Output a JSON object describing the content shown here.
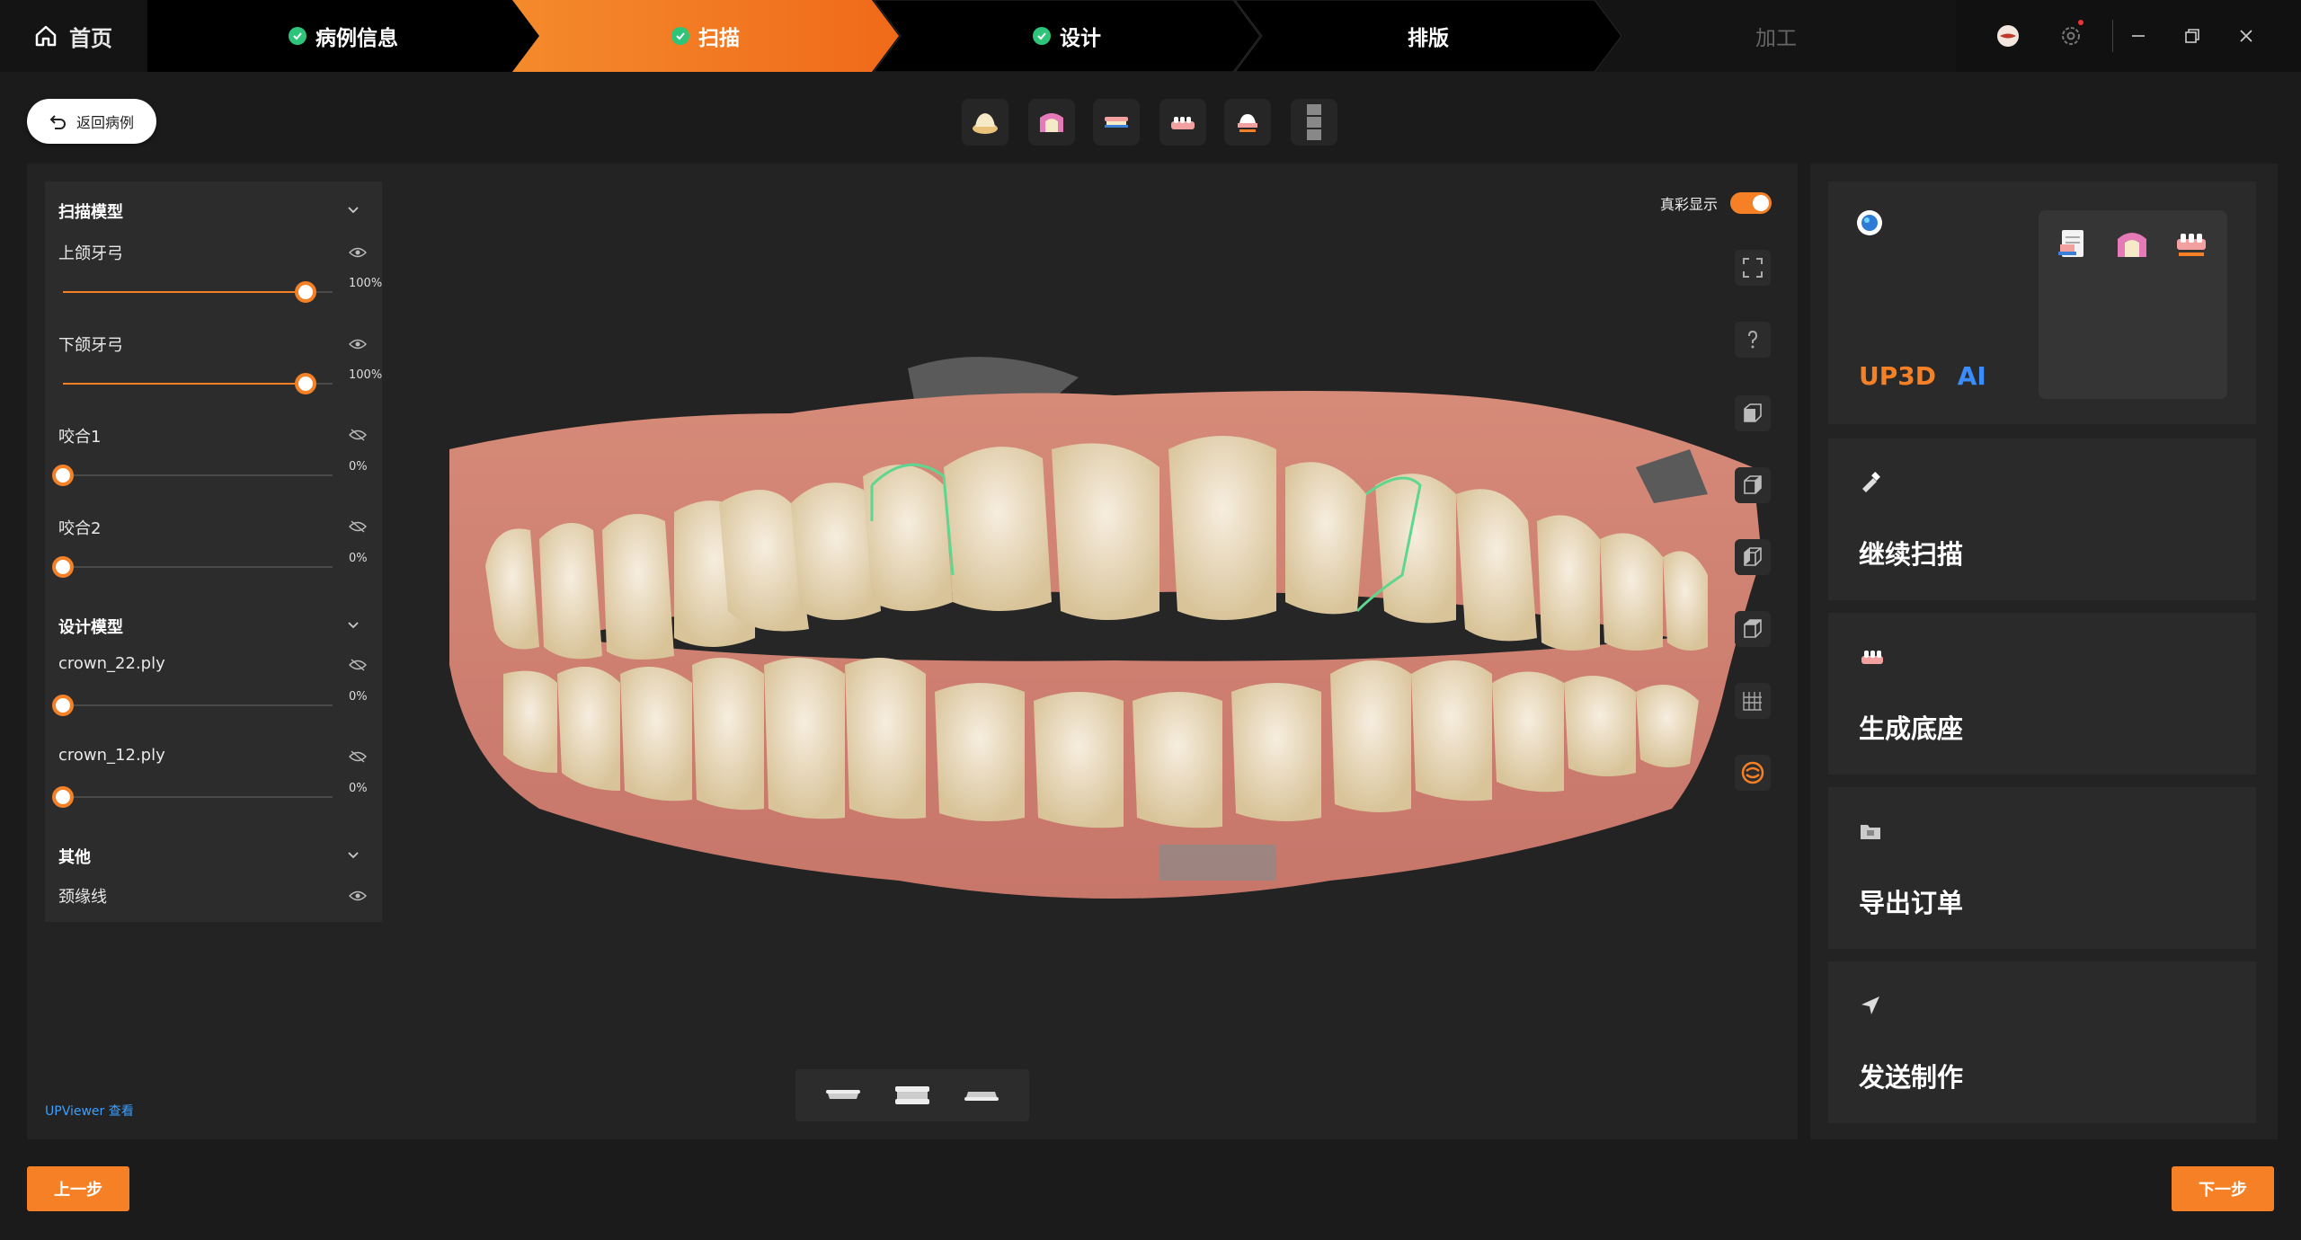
{
  "nav": {
    "home_label": "首页",
    "steps": [
      {
        "label": "病例信息",
        "state": "done"
      },
      {
        "label": "扫描",
        "state": "active"
      },
      {
        "label": "设计",
        "state": "done"
      },
      {
        "label": "排版",
        "state": "normal"
      },
      {
        "label": "加工",
        "state": "disabled"
      }
    ]
  },
  "toolbar": {
    "back_label": "返回病例",
    "tool_icons": [
      "crown-tool-icon",
      "gum-tool-icon",
      "arch-tool-icon",
      "base-tool-icon",
      "online-tool-icon",
      "grip-handle-icon"
    ]
  },
  "layers": {
    "scan_section": "扫描模型",
    "upper": {
      "label": "上颌牙弓",
      "pct_label": "100%",
      "value": 100
    },
    "lower": {
      "label": "下颌牙弓",
      "pct_label": "100%",
      "value": 100
    },
    "bite1": {
      "label": "咬合1",
      "pct_label": "0%",
      "value": 0
    },
    "bite2": {
      "label": "咬合2",
      "pct_label": "0%",
      "value": 0
    },
    "design_section": "设计模型",
    "crown22": {
      "label": "crown_22.ply",
      "pct_label": "0%",
      "value": 0
    },
    "crown12": {
      "label": "crown_12.ply",
      "pct_label": "0%",
      "value": 0
    },
    "other_section": "其他",
    "margin": {
      "label": "颈缘线"
    }
  },
  "viewer": {
    "true_color_label": "真彩显示",
    "true_color_on": true,
    "upviewer_link": "UPViewer 查看"
  },
  "right": {
    "ai_brand_a": "UP3D",
    "ai_brand_b": "AI",
    "cards": [
      {
        "title": "继续扫描",
        "icon": "scanner-icon"
      },
      {
        "title": "生成底座",
        "icon": "base-icon"
      },
      {
        "title": "导出订单",
        "icon": "folder-icon"
      },
      {
        "title": "发送制作",
        "icon": "send-icon"
      }
    ]
  },
  "footer": {
    "prev_label": "上一步",
    "next_label": "下一步"
  },
  "colors": {
    "accent": "#f58025",
    "done": "#2ec47a",
    "link": "#3aa0ff"
  }
}
